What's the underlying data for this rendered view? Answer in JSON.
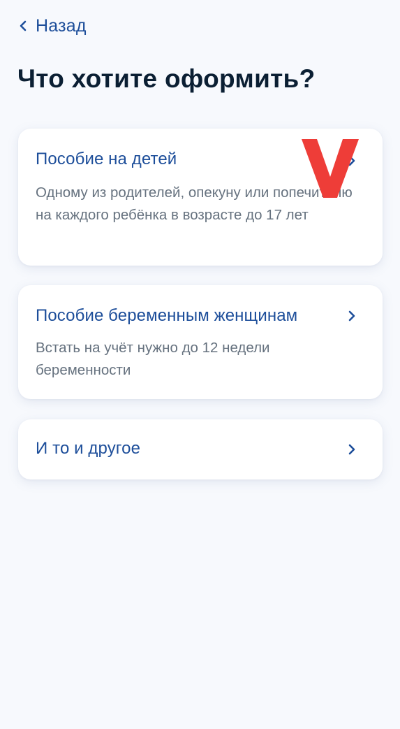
{
  "header": {
    "back_label": "Назад",
    "title": "Что хотите оформить?"
  },
  "options": [
    {
      "title": "Пособие на детей",
      "description": "Одному из родителей, опекуну или попечителю на каждого ребёнка в возрасте до 17 лет"
    },
    {
      "title": "Пособие беременным женщинам",
      "description": "Встать на учёт нужно до 12 недели беременности"
    },
    {
      "title": "И то и другое"
    }
  ],
  "annotation": {
    "mark": "V",
    "color": "#ee3d38"
  },
  "colors": {
    "accent": "#1d4e9a",
    "title": "#0b1f33",
    "muted": "#66727f",
    "background": "#f7f9fd"
  }
}
